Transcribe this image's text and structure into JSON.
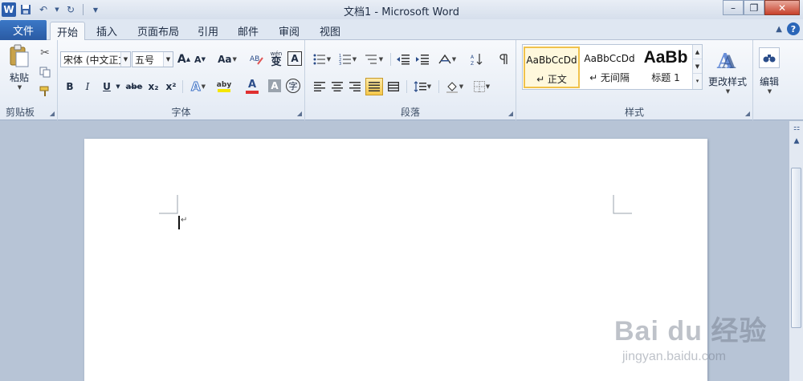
{
  "window": {
    "title": "文档1 - Microsoft Word",
    "logo_letter": "W"
  },
  "tabs": {
    "file": "文件",
    "items": [
      "开始",
      "插入",
      "页面布局",
      "引用",
      "邮件",
      "审阅",
      "视图"
    ],
    "active": "开始"
  },
  "clipboard": {
    "paste_label": "粘贴",
    "group_label": "剪贴板"
  },
  "font": {
    "font_name": "宋体 (中文正文",
    "font_size": "五号",
    "grow": "A",
    "shrink": "A",
    "change_case": "Aa",
    "pinyin": "wén",
    "pinyin_char": "变",
    "border_char": "A",
    "bold": "B",
    "italic": "I",
    "underline": "U",
    "strike": "abe",
    "subscript": "x₂",
    "superscript": "x²",
    "effects": "A",
    "highlight": "aby",
    "font_color": "A",
    "shading": "A",
    "enclose": "字",
    "group_label": "字体"
  },
  "paragraph": {
    "group_label": "段落"
  },
  "styles": {
    "items": [
      {
        "sample": "AaBbCcDd",
        "name": "↵ 正文",
        "selected": true
      },
      {
        "sample": "AaBbCcDd",
        "name": "↵ 无间隔",
        "selected": false
      },
      {
        "sample": "AaBb",
        "name": "标题 1",
        "selected": false
      }
    ],
    "change_styles": "更改样式",
    "group_label": "样式"
  },
  "editing": {
    "label": "编辑"
  },
  "watermark": {
    "main": "Bai du 经验",
    "sub": "jingyan.baidu.com"
  },
  "colors": {
    "accent_blue": "#2b5ead",
    "highlight_yellow": "#f5e600",
    "font_red": "#e03030",
    "selected_style": "#f0c24b"
  }
}
